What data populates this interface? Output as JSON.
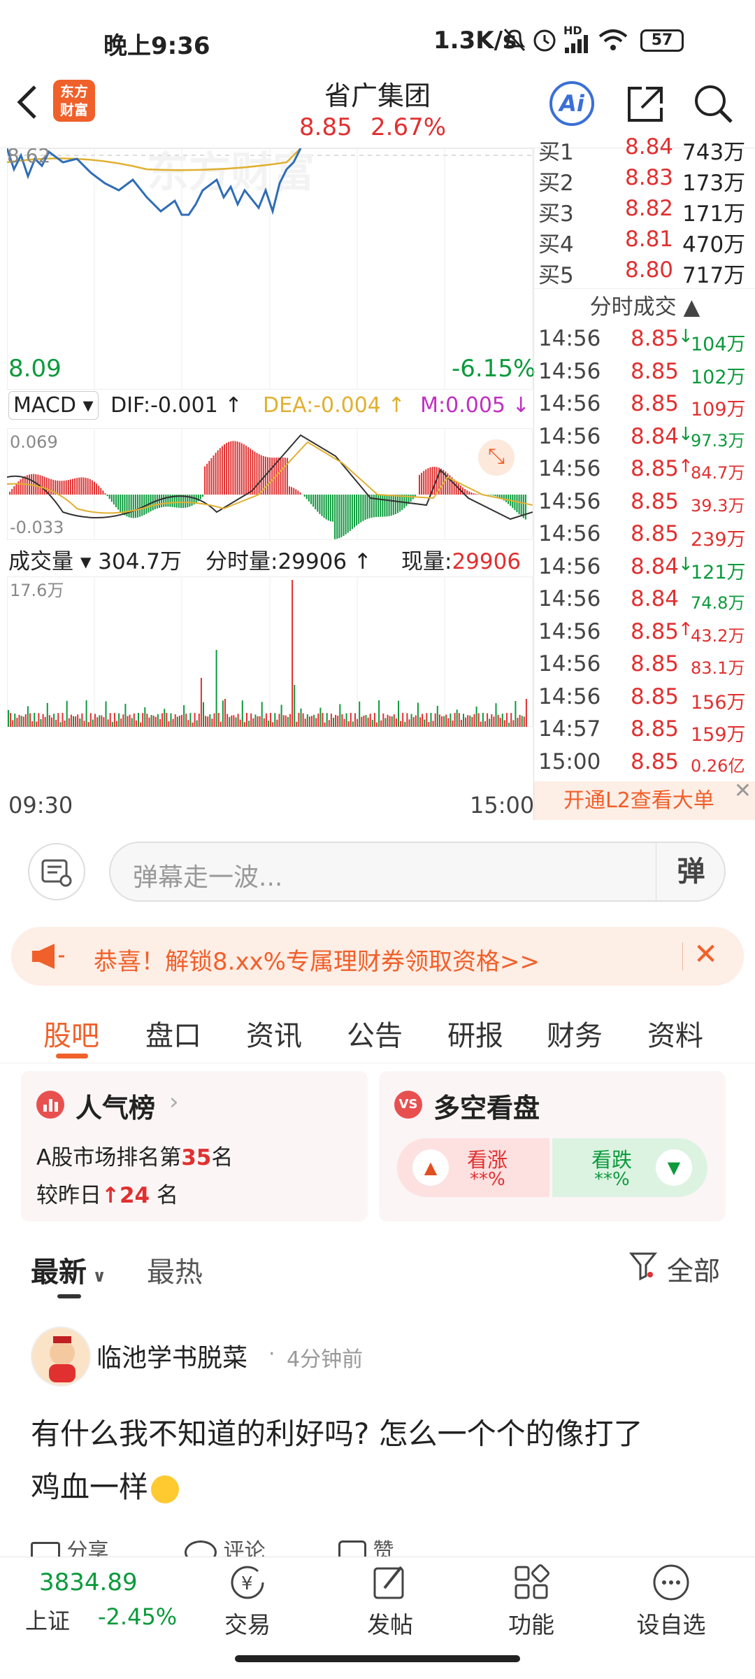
{
  "status": {
    "time": "晚上9:36",
    "net_speed": "1.3K/s",
    "network_label": "HD",
    "battery": "57"
  },
  "header": {
    "title": "省广集团",
    "price": "8.85",
    "change_pct": "2.67%",
    "logo_text_1": "东方",
    "logo_text_2": "财富",
    "ai_label": "Ai"
  },
  "chart": {
    "price_top_label": "8.62",
    "price_low": "8.09",
    "pct_low": "-6.15%",
    "macd": {
      "label": "MACD",
      "dif": "DIF:-0.001",
      "dea": "DEA:-0.004",
      "m": "M:0.005",
      "top": "0.069",
      "bottom": "-0.033"
    },
    "volume": {
      "label": "成交量",
      "total": "304.7万",
      "minute_label": "分时量:",
      "minute_val": "29906",
      "cur_label": "现量:",
      "cur_val": "29906",
      "top": "17.6万"
    },
    "time_start": "09:30",
    "time_end": "15:00",
    "watermark": "东方财富"
  },
  "orderbook": {
    "bids": [
      {
        "label": "买1",
        "price": "8.84",
        "vol": "743万"
      },
      {
        "label": "买2",
        "price": "8.83",
        "vol": "173万"
      },
      {
        "label": "买3",
        "price": "8.82",
        "vol": "171万"
      },
      {
        "label": "买4",
        "price": "8.81",
        "vol": "470万"
      },
      {
        "label": "买5",
        "price": "8.80",
        "vol": "717万"
      }
    ],
    "ticks_title": "分时成交",
    "ticks": [
      {
        "time": "14:56",
        "price": "8.85",
        "dir": "↓",
        "vol": "104万",
        "color": "green"
      },
      {
        "time": "14:56",
        "price": "8.85",
        "dir": "",
        "vol": "102万",
        "color": "green"
      },
      {
        "time": "14:56",
        "price": "8.85",
        "dir": "",
        "vol": "109万",
        "color": "red"
      },
      {
        "time": "14:56",
        "price": "8.84",
        "dir": "↓",
        "vol": "97.3万",
        "color": "green"
      },
      {
        "time": "14:56",
        "price": "8.85",
        "dir": "↑",
        "vol": "84.7万",
        "color": "red"
      },
      {
        "time": "14:56",
        "price": "8.85",
        "dir": "",
        "vol": "39.3万",
        "color": "red"
      },
      {
        "time": "14:56",
        "price": "8.85",
        "dir": "",
        "vol": "239万",
        "color": "red"
      },
      {
        "time": "14:56",
        "price": "8.84",
        "dir": "↓",
        "vol": "121万",
        "color": "green"
      },
      {
        "time": "14:56",
        "price": "8.84",
        "dir": "",
        "vol": "74.8万",
        "color": "green"
      },
      {
        "time": "14:56",
        "price": "8.85",
        "dir": "↑",
        "vol": "43.2万",
        "color": "red"
      },
      {
        "time": "14:56",
        "price": "8.85",
        "dir": "",
        "vol": "83.1万",
        "color": "red"
      },
      {
        "time": "14:56",
        "price": "8.85",
        "dir": "",
        "vol": "156万",
        "color": "red"
      },
      {
        "time": "14:57",
        "price": "8.85",
        "dir": "",
        "vol": "159万",
        "color": "red"
      },
      {
        "time": "15:00",
        "price": "8.85",
        "dir": "",
        "vol": "0.26亿",
        "color": "red"
      }
    ],
    "l2_banner": "开通L2查看大单"
  },
  "danmu": {
    "placeholder": "弹幕走一波...",
    "btn": "弹"
  },
  "promo": {
    "text": "恭喜！解锁8.xx%专属理财券领取资格>>"
  },
  "tabs": [
    "股吧",
    "盘口",
    "资讯",
    "公告",
    "研报",
    "财务",
    "资料"
  ],
  "cards": {
    "popular": {
      "title": "人气榜",
      "line1_prefix": "A股市场排名第",
      "rank": "35",
      "line1_suffix": "名",
      "line2_prefix": "较昨日",
      "change": "24",
      "line2_suffix": "名"
    },
    "vote": {
      "title": "多空看盘",
      "up_label": "看涨",
      "up_val": "**%",
      "down_label": "看跌",
      "down_val": "**%"
    }
  },
  "feed": {
    "tab_latest": "最新",
    "tab_hot": "最热",
    "filter": "全部"
  },
  "post": {
    "author": "临池学书脱菜",
    "time": "4分钟前",
    "text_line1": "有什么我不知道的利好吗? 怎么一个个的像打了",
    "text_line2": "鸡血一样",
    "share": "分享",
    "comment": "评论",
    "like": "赞"
  },
  "bottom": {
    "index_value": "3834.89",
    "index_name": "上证",
    "index_change": "-2.45%",
    "items": [
      "交易",
      "发帖",
      "功能",
      "设自选"
    ]
  },
  "colors": {
    "up": "#e03030",
    "down": "#0c9a3c",
    "accent": "#f0602a",
    "price_line": "#2f6db5",
    "avg_line": "#e0b030"
  }
}
